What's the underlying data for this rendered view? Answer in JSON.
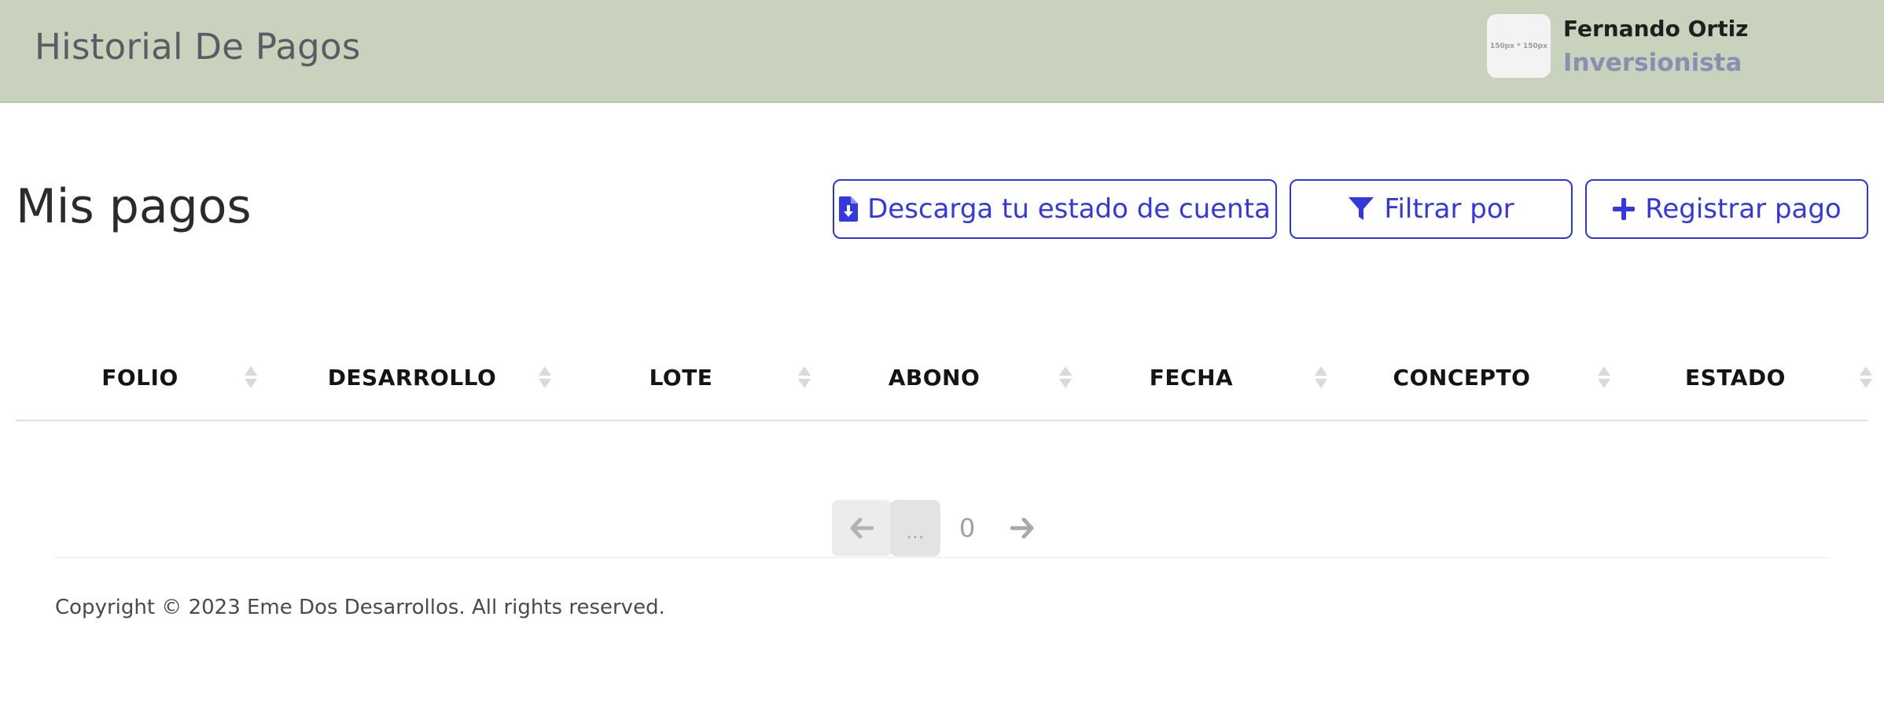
{
  "header": {
    "title": "Historial De Pagos",
    "avatar_placeholder": "150px * 150px",
    "user_name": "Fernando Ortiz",
    "user_role": "Inversionista"
  },
  "main": {
    "section_title": "Mis pagos",
    "buttons": {
      "download": "Descarga tu estado de cuenta",
      "filter": "Filtrar por",
      "register": "Registrar pago"
    }
  },
  "table": {
    "columns": [
      "FOLIO",
      "DESARROLLO",
      "LOTE",
      "ABONO",
      "FECHA",
      "CONCEPTO",
      "ESTADO"
    ],
    "rows": []
  },
  "pagination": {
    "ellipsis": "...",
    "current_page": "0"
  },
  "footer": {
    "copyright": "Copyright © 2023 Eme Dos Desarrollos. All rights reserved."
  },
  "colors": {
    "header_bg": "#c9d2bd",
    "accent": "#3438e0",
    "role_text": "#8a8fb1"
  },
  "icons": {
    "download": "file-download-icon",
    "filter": "funnel-icon",
    "register": "plus-icon",
    "sort": "sort-icon",
    "prev": "arrow-left-icon",
    "next": "arrow-right-icon"
  }
}
